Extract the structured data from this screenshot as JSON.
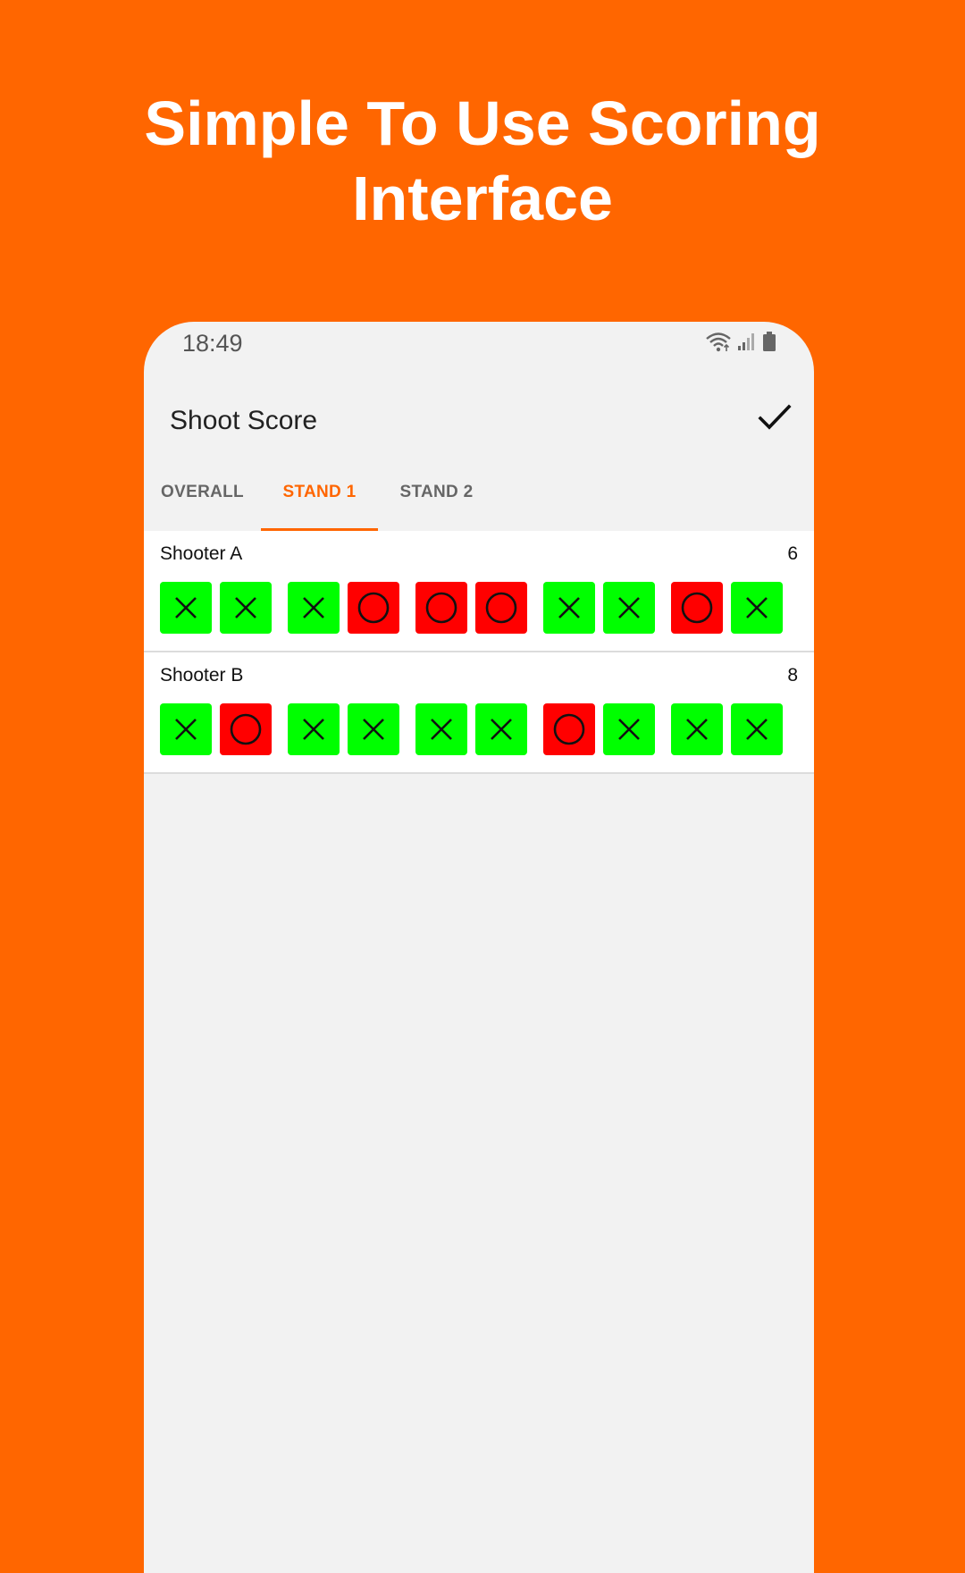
{
  "headline": {
    "line1": "Simple To Use Scoring",
    "line2": "Interface"
  },
  "status_bar": {
    "time": "18:49",
    "icons": [
      "wifi-icon",
      "signal-icon",
      "battery-icon"
    ]
  },
  "app_bar": {
    "title": "Shoot Score",
    "action_icon": "check-icon"
  },
  "tabs": [
    {
      "label": "OVERALL",
      "active": false
    },
    {
      "label": "STAND 1",
      "active": true
    },
    {
      "label": "STAND 2",
      "active": false
    }
  ],
  "shooters": [
    {
      "name": "Shooter A",
      "score": "6",
      "shots": [
        "hit",
        "hit",
        "hit",
        "miss",
        "miss",
        "miss",
        "hit",
        "hit",
        "miss",
        "hit"
      ]
    },
    {
      "name": "Shooter B",
      "score": "8",
      "shots": [
        "hit",
        "miss",
        "hit",
        "hit",
        "hit",
        "hit",
        "miss",
        "hit",
        "hit",
        "hit"
      ]
    }
  ],
  "colors": {
    "background": "#FF6600",
    "accent": "#FF6600",
    "hit": "#00FF00",
    "miss": "#FF0000"
  }
}
